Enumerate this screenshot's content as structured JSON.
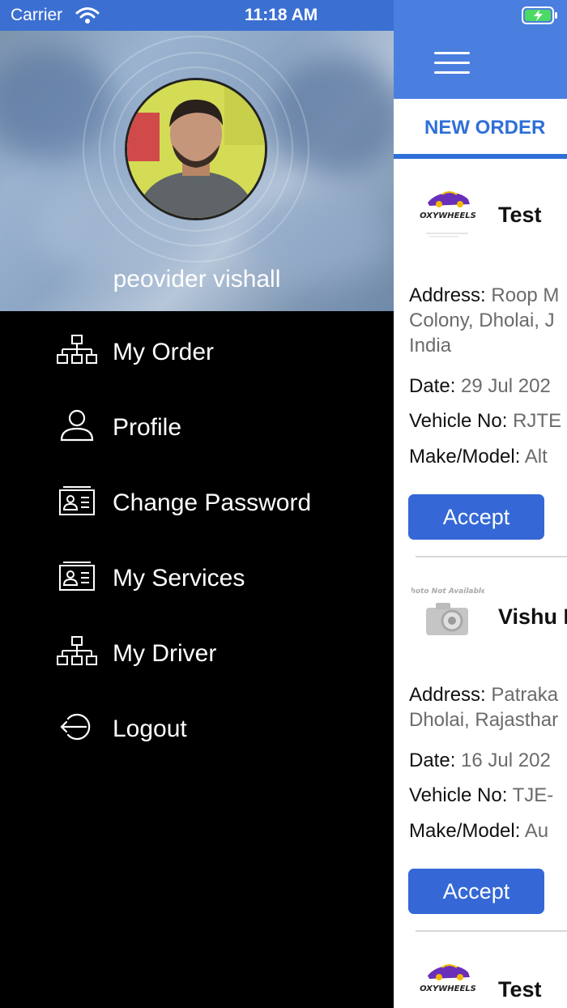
{
  "status_bar": {
    "carrier": "Carrier",
    "time": "11:18 AM"
  },
  "drawer": {
    "user_name": "peovider vishall",
    "menu": [
      {
        "label": "My Order",
        "icon": "sitemap-icon"
      },
      {
        "label": "Profile",
        "icon": "user-icon"
      },
      {
        "label": "Change Password",
        "icon": "id-card-icon"
      },
      {
        "label": "My Services",
        "icon": "id-card-icon"
      },
      {
        "label": "My Driver",
        "icon": "sitemap-icon"
      },
      {
        "label": "Logout",
        "icon": "logout-icon"
      }
    ]
  },
  "main": {
    "tab": "NEW ORDER",
    "orders": [
      {
        "logo": "oxywheels-logo",
        "logo_text": "OXYWHEELS",
        "title": "Test",
        "address_label": "Address:",
        "address_lines": [
          "Roop M",
          "Colony, Dholai, J",
          "India"
        ],
        "date_label": "Date:",
        "date": "29 Jul 202",
        "vehicle_label": "Vehicle No:",
        "vehicle": "RJTE",
        "make_label": "Make/Model:",
        "make": "Alt",
        "accept": "Accept"
      },
      {
        "logo": "photo-not-available",
        "logo_text": "Photo Not Available",
        "title": "Vishu I",
        "address_label": "Address:",
        "address_lines": [
          "Patraka",
          "Dholai, Rajasthar"
        ],
        "date_label": "Date:",
        "date": "16 Jul 202",
        "vehicle_label": "Vehicle No:",
        "vehicle": "TJE-",
        "make_label": "Make/Model:",
        "make": "Au",
        "accept": "Accept"
      },
      {
        "logo": "oxywheels-logo",
        "logo_text": "OXYWHEELS",
        "title": "Test"
      }
    ]
  },
  "colors": {
    "nav_blue": "#4a7fe0",
    "accent_blue": "#2f6fd8",
    "button_blue": "#3568d6"
  }
}
